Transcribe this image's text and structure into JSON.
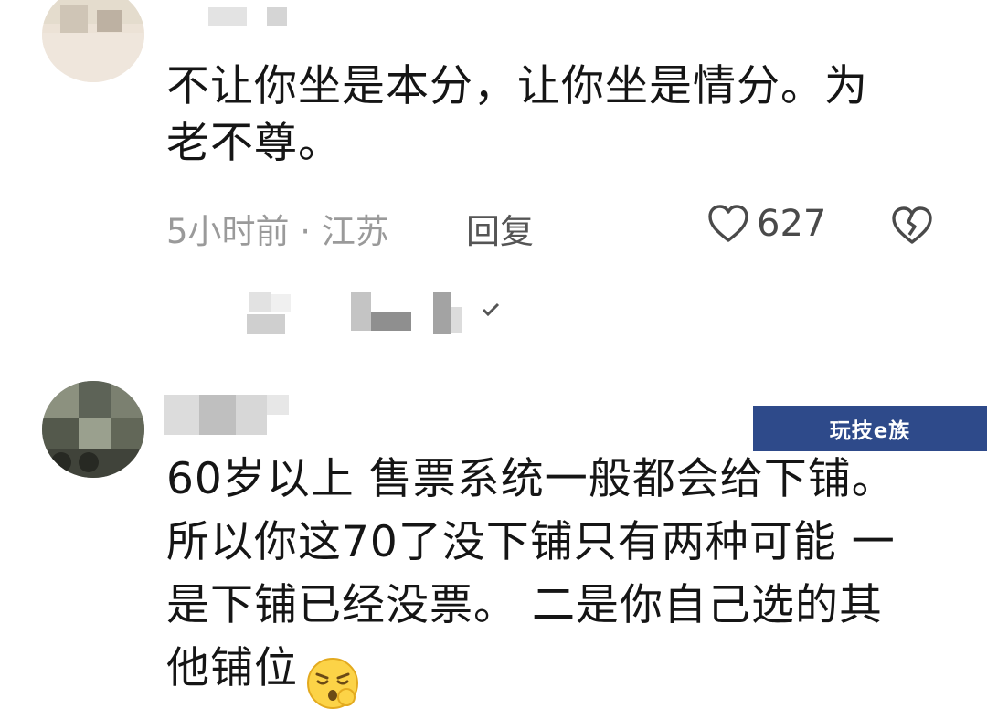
{
  "comments": [
    {
      "text_lines": [
        "不让你坐是本分，让你坐是情分。为",
        "老不尊。"
      ],
      "time_location": "5小时前 · 江苏",
      "reply_label": "回复",
      "like_count": "627"
    },
    {
      "text_lines": [
        "60岁以上 售票系统一般都会给下铺。",
        "所以你这70了没下铺只有两种可能  一",
        "是下铺已经没票。 二是你自己选的其",
        "他铺位"
      ],
      "emoji": "thinking-face-emoji"
    }
  ],
  "watermark": {
    "text": "玩技e族"
  },
  "icons": [
    "heart-icon",
    "broken-heart-icon",
    "checkmark-icon"
  ],
  "colors": {
    "text": "#151515",
    "meta": "#9a9a9a",
    "watermark_bg": "#2e4a8a"
  }
}
